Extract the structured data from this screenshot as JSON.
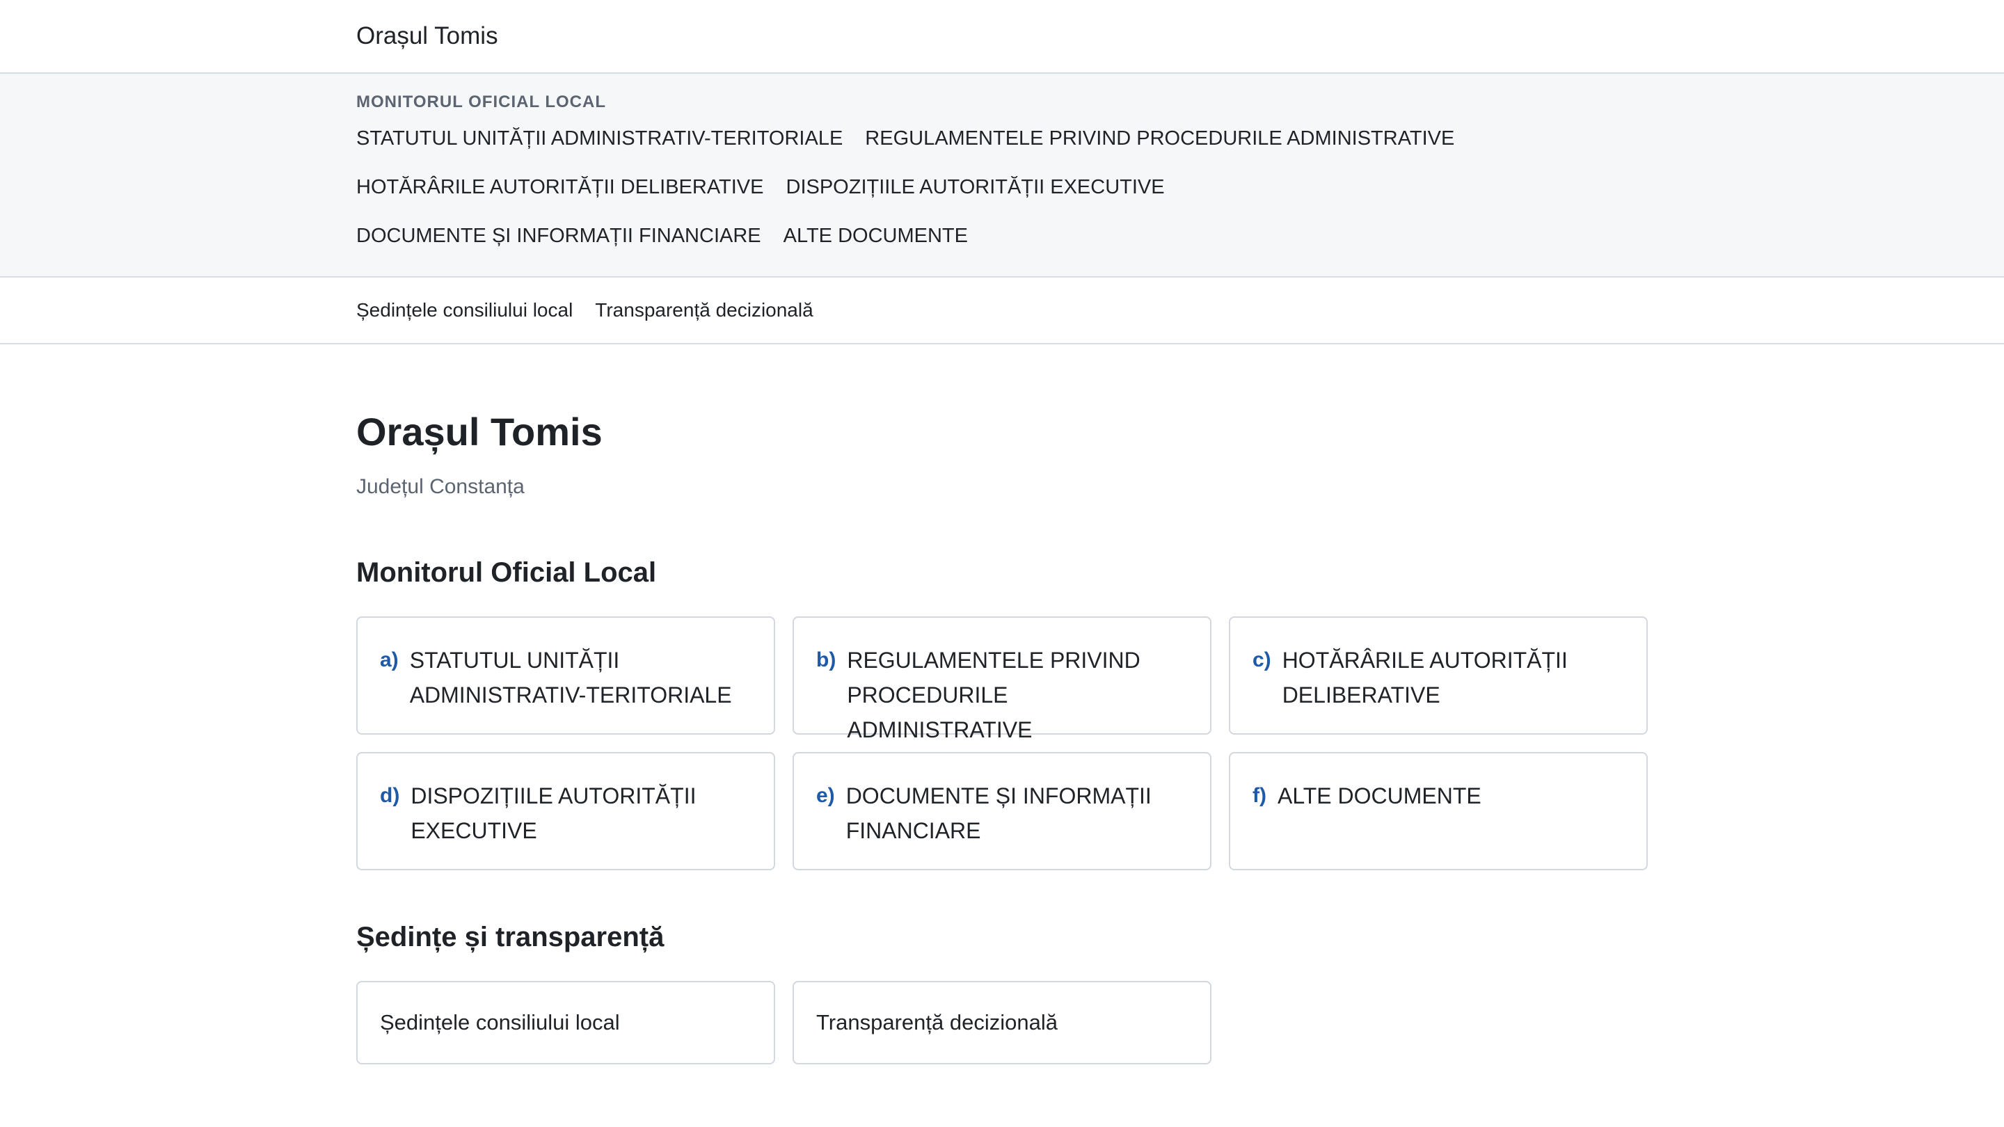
{
  "header": {
    "site_title": "Orașul Tomis"
  },
  "monitor_nav": {
    "heading": "MONITORUL OFICIAL LOCAL",
    "links": [
      "STATUTUL UNITĂȚII ADMINISTRATIV-TERITORIALE",
      "REGULAMENTELE PRIVIND PROCEDURILE ADMINISTRATIVE",
      "HOTĂRÂRILE AUTORITĂȚII DELIBERATIVE",
      "DISPOZIȚIILE AUTORITĂȚII EXECUTIVE",
      "DOCUMENTE ȘI INFORMAȚII FINANCIARE",
      "ALTE DOCUMENTE"
    ]
  },
  "sub_nav": {
    "links": [
      "Ședințele consiliului local",
      "Transparență decizională"
    ]
  },
  "main": {
    "title": "Orașul Tomis",
    "subtitle": "Județul Constanța",
    "monitor_section": {
      "heading": "Monitorul Oficial Local",
      "cards": [
        {
          "letter": "a)",
          "label": "STATUTUL UNITĂȚII ADMINISTRATIV-TERITORIALE"
        },
        {
          "letter": "b)",
          "label": "REGULAMENTELE PRIVIND PROCEDURILE ADMINISTRATIVE"
        },
        {
          "letter": "c)",
          "label": "HOTĂRÂRILE AUTORITĂȚII DELIBERATIVE"
        },
        {
          "letter": "d)",
          "label": "DISPOZIȚIILE AUTORITĂȚII EXECUTIVE"
        },
        {
          "letter": "e)",
          "label": "DOCUMENTE ȘI INFORMAȚII FINANCIARE"
        },
        {
          "letter": "f)",
          "label": "ALTE DOCUMENTE"
        }
      ]
    },
    "sedinte_section": {
      "heading": "Ședințe și transparență",
      "cards": [
        {
          "label": "Ședințele consiliului local"
        },
        {
          "label": "Transparență decizională"
        }
      ]
    }
  },
  "colors": {
    "accent_letter": "#1e5aa8",
    "nav_band_bg": "#f5f7f9",
    "border": "#d3d8de",
    "muted_text": "#5b6470"
  }
}
